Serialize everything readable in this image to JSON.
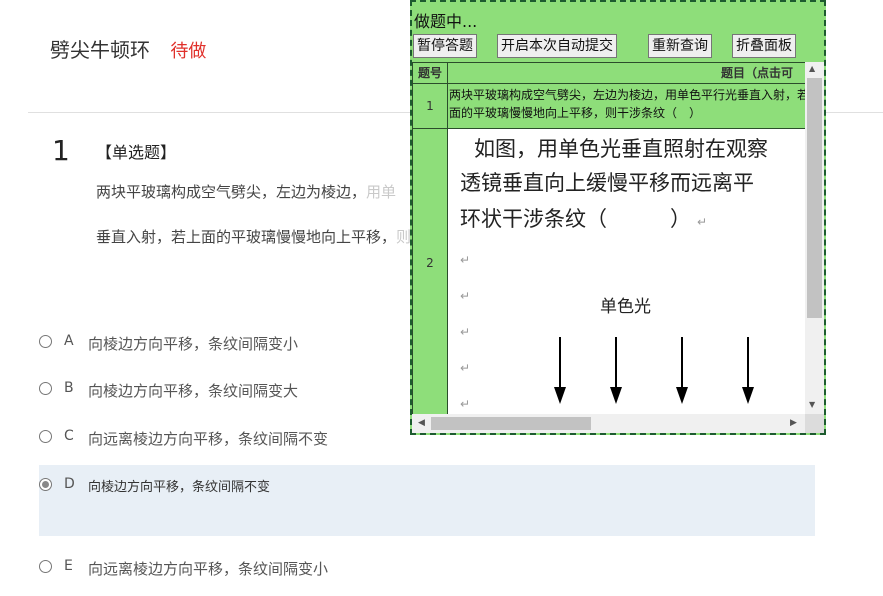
{
  "header": {
    "title": "劈尖牛顿环",
    "status": "待做"
  },
  "question": {
    "number": "1",
    "type": "【单选题】",
    "line1_visible": "两块平玻璃构成空气劈尖，左边为棱边，",
    "line1_faded": "用单",
    "line2_visible": "垂直入射，若上面的平玻璃慢慢地向上平移，",
    "line2_faded": "则"
  },
  "options": [
    {
      "letter": "A",
      "text": "向棱边方向平移，条纹间隔变小",
      "selected": false
    },
    {
      "letter": "B",
      "text": "向棱边方向平移，条纹间隔变大",
      "selected": false
    },
    {
      "letter": "C",
      "text": "向远离棱边方向平移，条纹间隔不变",
      "selected": false
    },
    {
      "letter": "D",
      "text": "向棱边方向平移，条纹间隔不变",
      "selected": true
    },
    {
      "letter": "E",
      "text": "向远离棱边方向平移，条纹间隔变小",
      "selected": false
    }
  ],
  "panel": {
    "title": "做题中...",
    "buttons": {
      "pause": "暂停答题",
      "auto_submit": "开启本次自动提交",
      "refresh": "重新查询",
      "fold": "折叠面板"
    },
    "table": {
      "headers": {
        "no": "题号",
        "question": "题目（点击可"
      },
      "rows": [
        {
          "no": "1",
          "question": "两块平玻璃构成空气劈尖，左边为棱边，用单色平行光垂直入射，若上面的平玻璃慢慢地向上平移，则干涉条纹（　）"
        },
        {
          "no": "2",
          "doc_line1": "如图，用单色光垂直照射在观察",
          "doc_line2": "透镜垂直向上缓慢平移而远离平",
          "doc_line3": "环状干涉条纹（　　　）",
          "para_mark": "↵",
          "figure_label": "单色光"
        }
      ]
    }
  },
  "colors": {
    "panel_bg": "#8ede7a",
    "panel_border": "#1d5b2f",
    "status_red": "#e0302b",
    "selected_bg": "#e8eff6"
  }
}
